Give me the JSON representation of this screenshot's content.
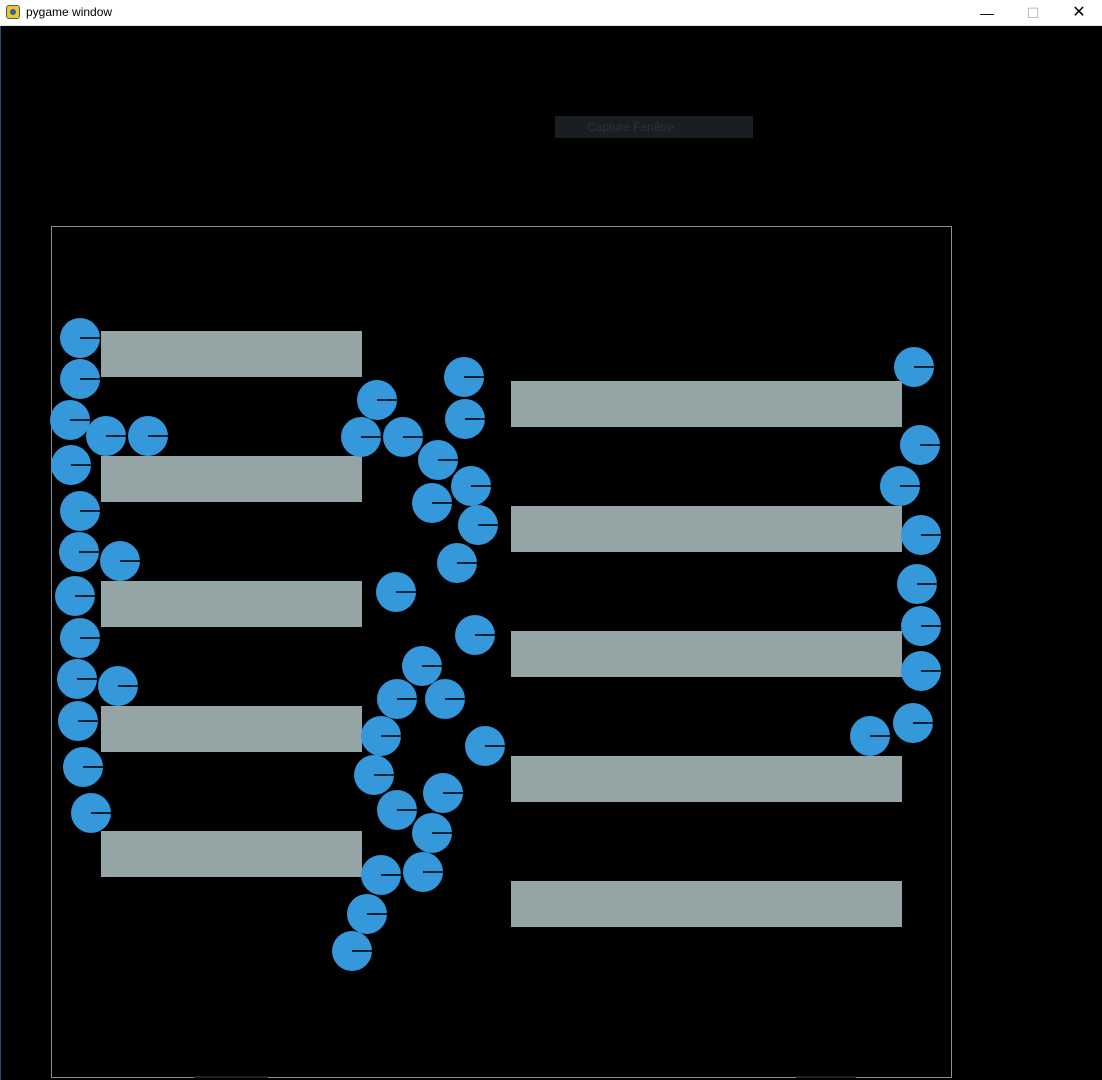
{
  "window": {
    "title": "pygame window",
    "minimize_glyph": "—",
    "maximize_glyph": "☐",
    "close_glyph": "✕"
  },
  "toolbar": {
    "capture_label": "Capture Fenêtre"
  },
  "colors": {
    "background": "#000000",
    "platform": "#95a5a6",
    "ball": "#3498db",
    "arena_border": "#8a8f92"
  },
  "scene": {
    "platform_count": 10,
    "ball_count": 56
  }
}
